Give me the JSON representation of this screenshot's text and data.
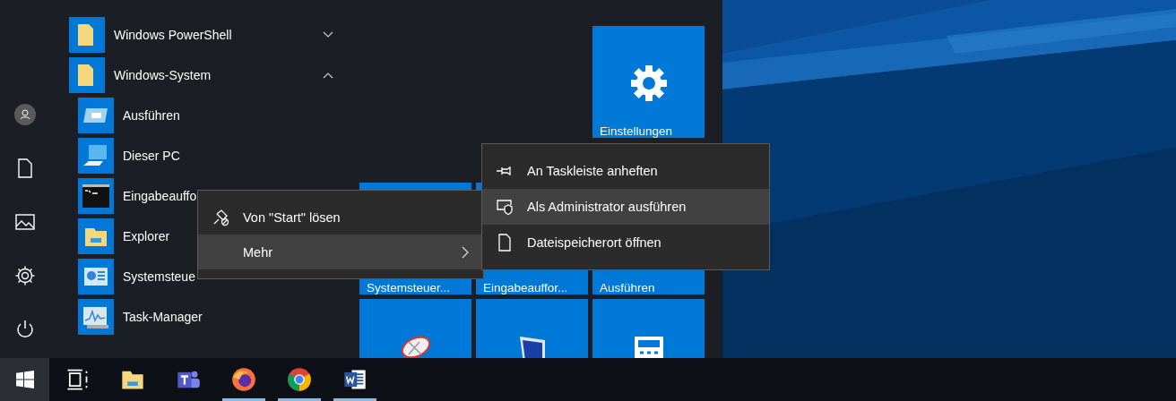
{
  "app_list": [
    {
      "label": "Windows PowerShell",
      "kind": "folder",
      "expanded": false
    },
    {
      "label": "Windows-System",
      "kind": "folder",
      "expanded": true,
      "children": [
        {
          "label": "Ausführen",
          "kind": "run"
        },
        {
          "label": "Dieser PC",
          "kind": "pc"
        },
        {
          "label": "Eingabeauffo",
          "kind": "prompt"
        },
        {
          "label": "Explorer",
          "kind": "explorer"
        },
        {
          "label": "Systemsteue",
          "kind": "control-panel"
        },
        {
          "label": "Task-Manager",
          "kind": "task-manager"
        }
      ]
    }
  ],
  "tiles_top": [
    {
      "label": "Einstellungen",
      "kind": "settings"
    }
  ],
  "tiles": [
    {
      "label": "Systemsteuer..."
    },
    {
      "label": "Eingabeauffor..."
    },
    {
      "label": "Ausführen"
    },
    {
      "kind": "satellite"
    },
    {
      "kind": "pc"
    },
    {
      "kind": "calculator"
    }
  ],
  "context_menu": {
    "items": [
      {
        "label": "Von \"Start\" lösen",
        "kind": "unpin",
        "selected": false,
        "submenu": false
      },
      {
        "label": "Mehr",
        "selected": true,
        "submenu": true
      }
    ]
  },
  "submenu": {
    "items": [
      {
        "label": "An Taskleiste anheften",
        "kind": "pin",
        "selected": false
      },
      {
        "label": "Als Administrator ausführen",
        "kind": "admin",
        "selected": true
      },
      {
        "label": "Dateispeicherort öffnen",
        "kind": "file",
        "selected": false
      }
    ]
  },
  "taskbar": {
    "items": [
      {
        "kind": "task-view",
        "running": false
      },
      {
        "kind": "explorer",
        "running": false
      },
      {
        "kind": "teams",
        "running": false
      },
      {
        "kind": "firefox",
        "running": true
      },
      {
        "kind": "chrome",
        "running": true
      },
      {
        "kind": "word",
        "running": true
      }
    ]
  }
}
